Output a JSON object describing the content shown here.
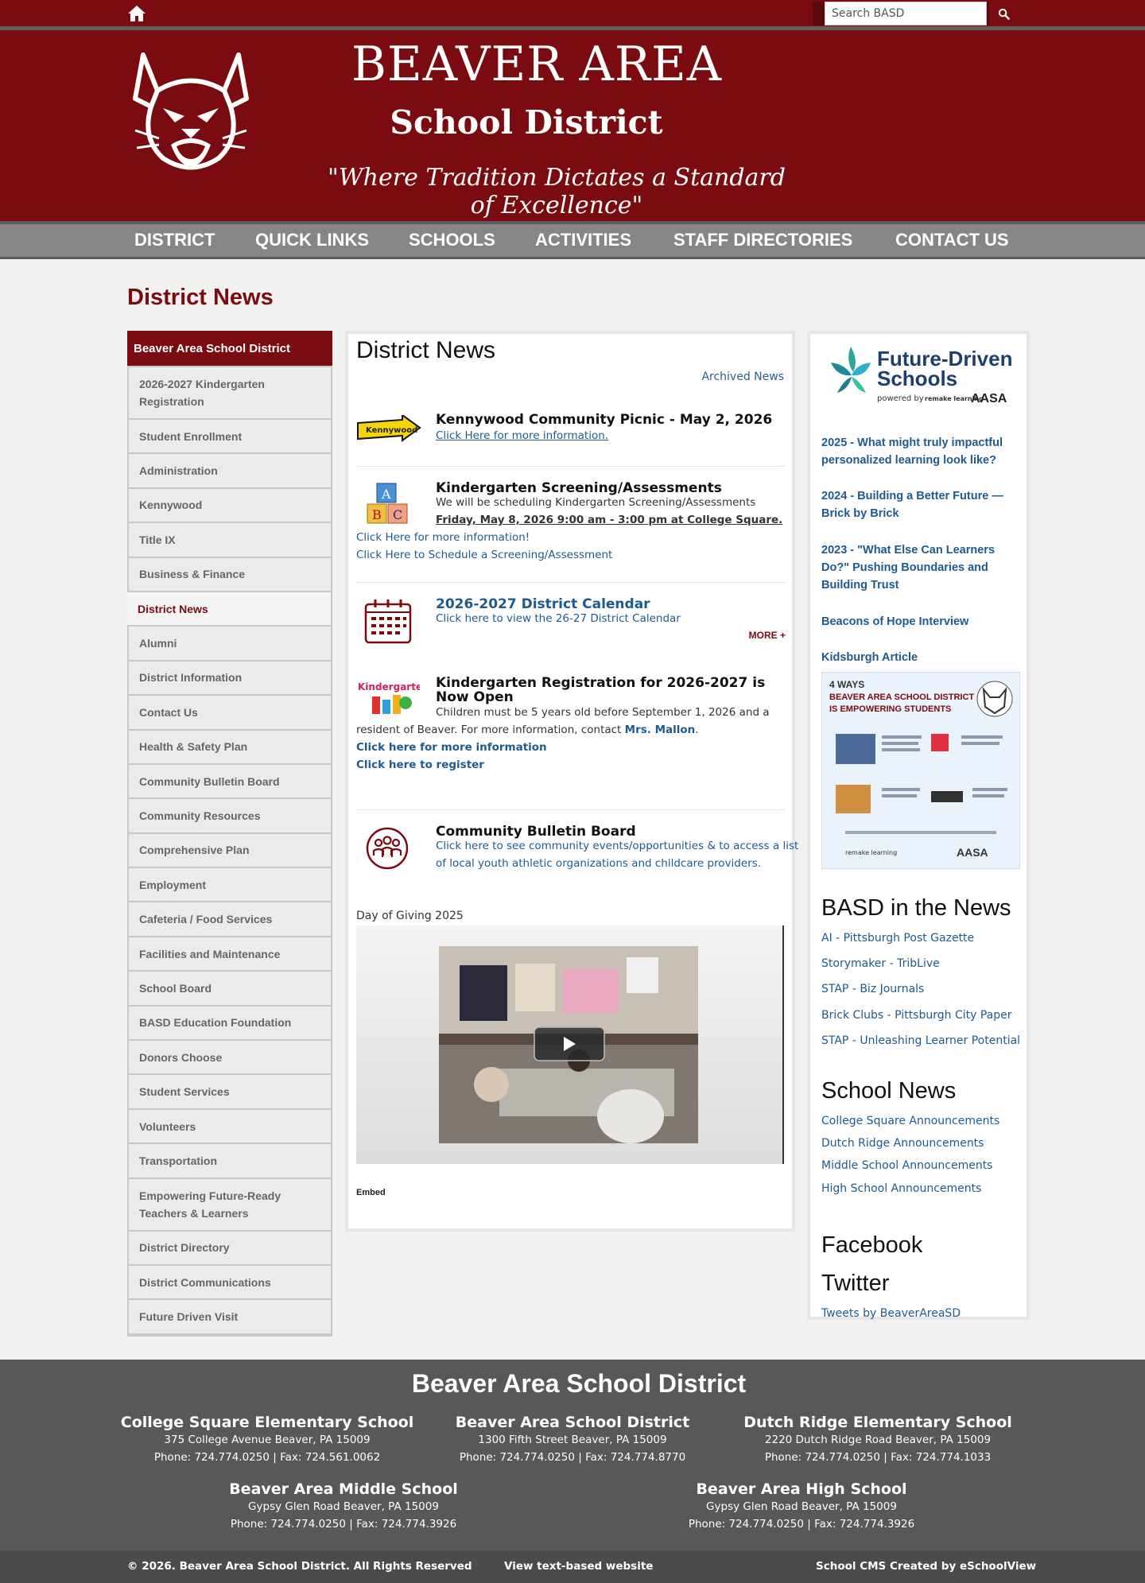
{
  "search": {
    "placeholder": "Search BASD"
  },
  "header": {
    "title": "BEAVER AREA",
    "subtitle": "School District",
    "motto": "\"Where Tradition Dictates a Standard of Excellence\""
  },
  "nav": [
    "DISTRICT",
    "QUICK LINKS",
    "SCHOOLS",
    "ACTIVITIES",
    "STAFF DIRECTORIES",
    "CONTACT US"
  ],
  "page_title": "District News",
  "sidebar": {
    "heading": "Beaver Area School District",
    "items": [
      "2026-2027 Kindergarten Registration",
      "Student Enrollment",
      "Administration",
      "Kennywood",
      "Title IX",
      "Business & Finance",
      "District News",
      "Alumni",
      "District Information",
      "Contact Us",
      "Health & Safety Plan",
      "Community Bulletin Board",
      "Community Resources",
      "Comprehensive Plan",
      "Employment",
      "Cafeteria / Food Services",
      "Facilities and Maintenance",
      "School Board",
      "BASD Education Foundation",
      "Donors Choose",
      "Student Services",
      "Volunteers",
      "Transportation",
      "Empowering Future-Ready Teachers & Learners",
      "District Directory",
      "District Communications",
      "Future Driven Visit"
    ]
  },
  "main": {
    "heading": "District News",
    "archived": "Archived News",
    "news": [
      {
        "title": "Kennywood Community Picnic - May 2, 2026",
        "link": "Click Here for more information.",
        "icon_label": "Kennywood"
      },
      {
        "title": "Kindergarten Screening/Assessments",
        "text": "We will be scheduling Kindergarten Screening/Assessments",
        "date": "Friday, May 8, 2026 9:00 am - 3:00 pm at College Square",
        "link1": "Click Here for more information!",
        "link2": "Click Here to Schedule a Screening/Assessment"
      },
      {
        "title": "2026-2027 District Calendar",
        "link": "Click here to view the 26-27 District Calendar",
        "more": "MORE +"
      },
      {
        "title": "Kindergarten Registration for 2026-2027 is Now Open",
        "text1": "Children must be 5 years old before September 1, 2026 and a",
        "text2": "resident of Beaver. For more information, contact",
        "contact": "Mrs. Mallon",
        "link1": "Click here for more information",
        "link2": "Click here to register",
        "icon_label": "Kindergarten!"
      },
      {
        "title": "Community Bulletin Board",
        "link1": "Click here to see community events/opportunities & to access a list",
        "link2": "of local youth athletic organizations and childcare providers."
      }
    ],
    "video_label": "Day of Giving 2025",
    "embed": "Embed"
  },
  "right": {
    "logo": {
      "line1": "Future-Driven",
      "line2": "Schools",
      "powered": "powered by",
      "brand1": "remake learning",
      "brand2": "AASA"
    },
    "links": [
      "2025 - What might truly impactful personalized learning look like?",
      "2024 - Building a Better Future — Brick by Brick",
      "2023 - \"What Else Can Learners Do?\" Pushing Boundaries and Building Trust",
      "Beacons of Hope Interview",
      "Kidsburgh Article"
    ],
    "poster": {
      "line1": "4 WAYS",
      "line2": "BEAVER AREA SCHOOL DISTRICT",
      "line3": "IS EMPOWERING STUDENTS"
    },
    "news_heading": "BASD in the News",
    "news_items": [
      "AI - Pittsburgh Post Gazette",
      "Storymaker - TribLive",
      "STAP - Biz Journals",
      "Brick Clubs - Pittsburgh City Paper",
      "STAP - Unleashing Learner Potential"
    ],
    "school_heading": "School News",
    "school_items": [
      "College Square Announcements",
      "Dutch Ridge Announcements",
      "Middle School Announcements",
      "High School Announcements"
    ],
    "facebook": "Facebook",
    "twitter": "Twitter",
    "tweets": "Tweets by BeaverAreaSD"
  },
  "footer": {
    "title": "Beaver Area School District",
    "schools": [
      {
        "name": "College Square Elementary School",
        "address": "375 College Avenue Beaver, PA 15009",
        "phone": "Phone: 724.774.0250 | Fax: 724.561.0062"
      },
      {
        "name": "Beaver Area School District",
        "address": "1300 Fifth Street Beaver, PA 15009",
        "phone": "Phone: 724.774.0250 | Fax: 724.774.8770"
      },
      {
        "name": "Dutch Ridge Elementary School",
        "address": "2220 Dutch Ridge Road Beaver, PA 15009",
        "phone": "Phone: 724.774.0250 | Fax: 724.774.1033"
      },
      {
        "name": "Beaver Area Middle School",
        "address": "Gypsy Glen Road Beaver, PA 15009",
        "phone": "Phone: 724.774.0250 | Fax: 724.774.3926"
      },
      {
        "name": "Beaver Area High School",
        "address": "Gypsy Glen Road Beaver, PA 15009",
        "phone": "Phone: 724.774.0250 | Fax: 724.774.3926"
      }
    ],
    "copyright": "© 2026. Beaver Area School District. All Rights Reserved",
    "text_site": "View text-based website",
    "cms": "School CMS Created by eSchoolView"
  },
  "colors": {
    "brand": "#7a0b10",
    "link": "#1d5b8f",
    "nav": "#868686",
    "footer": "#585858"
  }
}
